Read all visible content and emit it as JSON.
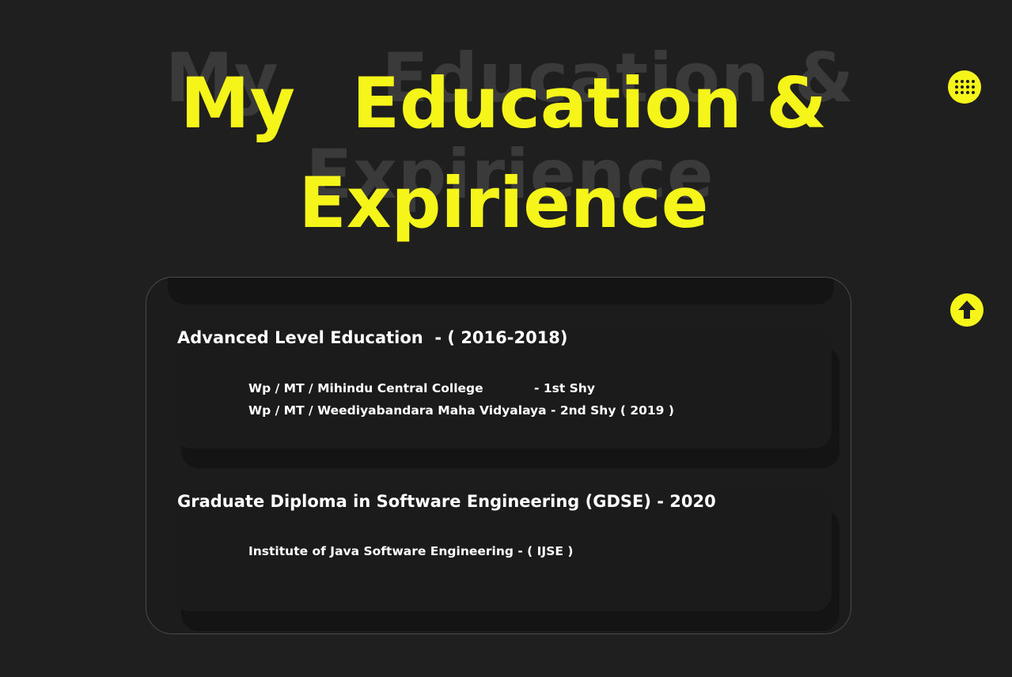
{
  "title": {
    "word1": "My",
    "word2": "Education &",
    "word3": "Expirience"
  },
  "nav": {
    "menu_icon": "grid-dots-icon",
    "scroll_top_icon": "arrow-up-icon"
  },
  "education": [
    {
      "heading": "Advanced Level Education  - ( 2016-2018)",
      "details": [
        {
          "school": "Wp / MT / Mihindu Central College",
          "note": "- 1st Shy"
        },
        {
          "school": "Wp / MT / Weediyabandara Maha Vidyalaya - 2nd Shy ( 2019 )",
          "note": ""
        }
      ]
    },
    {
      "heading": "Graduate Diploma in Software Engineering (GDSE) - 2020",
      "details": [
        {
          "school": "Institute of Java Software Engineering - ( IJSE )",
          "note": ""
        }
      ]
    }
  ],
  "colors": {
    "background": "#1f1f1f",
    "accent": "#f5f51a",
    "text": "#ffffff",
    "title_shadow": "#3a3a3a"
  }
}
